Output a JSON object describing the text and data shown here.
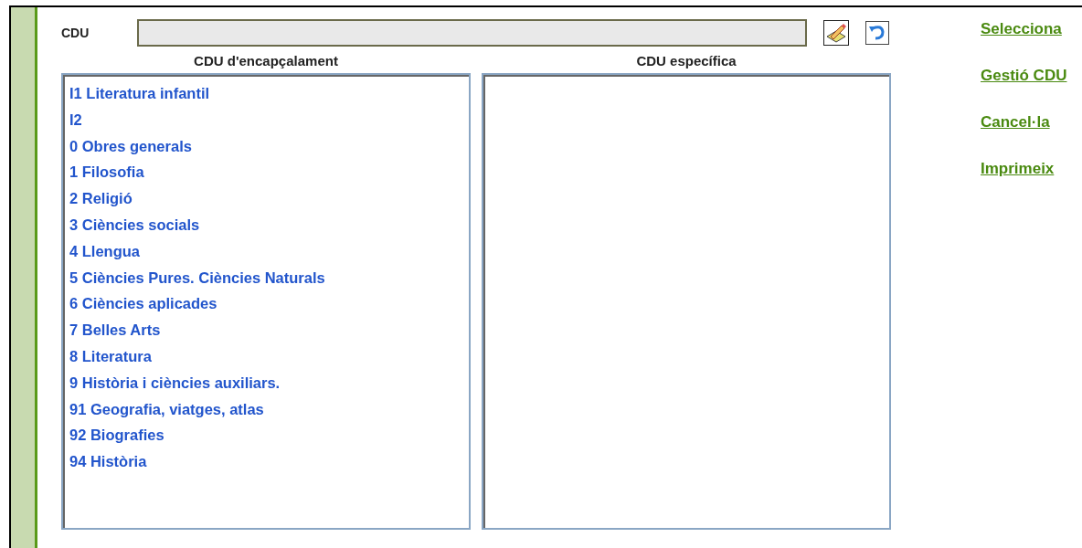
{
  "cdu_field": {
    "label": "CDU"
  },
  "lists": [
    {
      "heading": "CDU d'encapçalament",
      "items": [
        {
          "label": "I1 Literatura infantil"
        },
        {
          "label": "I2"
        },
        {
          "label": "0 Obres generals"
        },
        {
          "label": "1 Filosofia"
        },
        {
          "label": "2 Religió"
        },
        {
          "label": "3 Ciències socials"
        },
        {
          "label": "4 Llengua"
        },
        {
          "label": "5 Ciències Pures. Ciències Naturals"
        },
        {
          "label": "6 Ciències aplicades"
        },
        {
          "label": "7 Belles Arts"
        },
        {
          "label": "8 Literatura"
        },
        {
          "label": "9 Història i ciències auxiliars."
        },
        {
          "label": "91 Geografia, viatges, atlas"
        },
        {
          "label": "92 Biografies"
        },
        {
          "label": "94 Història"
        }
      ]
    },
    {
      "heading": "CDU específica"
    }
  ],
  "links": [
    "Selecciona",
    "Gestió CDU",
    "Cancel·la",
    "Imprimeix"
  ]
}
